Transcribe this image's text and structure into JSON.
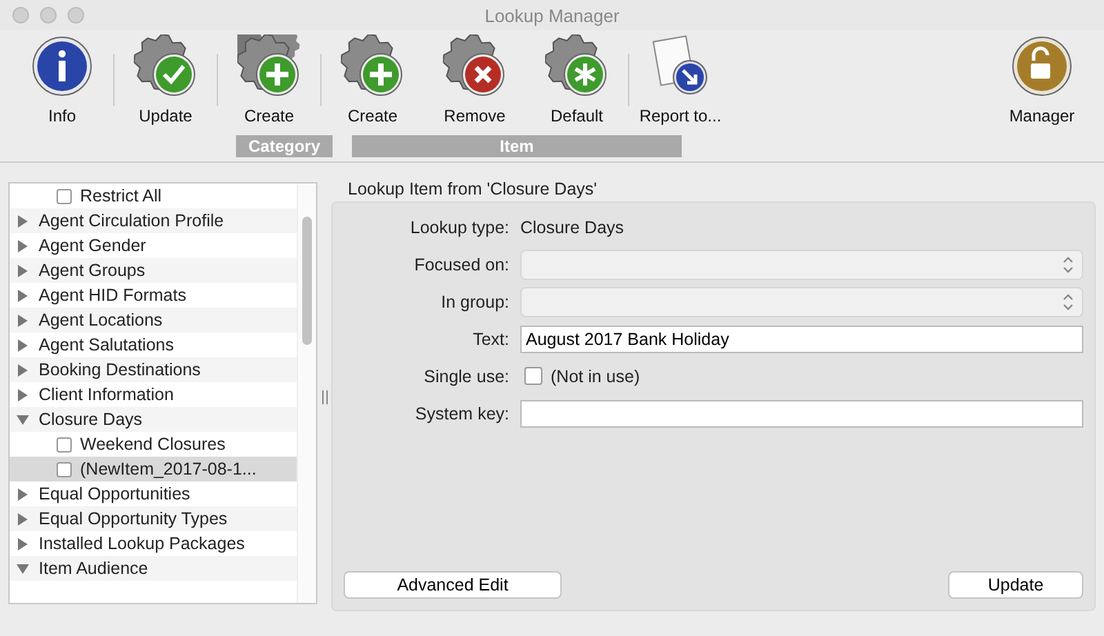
{
  "window": {
    "title": "Lookup Manager"
  },
  "toolbar": [
    {
      "label": "Info",
      "kind": "info"
    },
    {
      "label": "Update",
      "kind": "gear-check"
    },
    {
      "label": "Create",
      "kind": "gears-plus"
    },
    {
      "label": "Create",
      "kind": "gear-plus"
    },
    {
      "label": "Remove",
      "kind": "gear-remove"
    },
    {
      "label": "Default",
      "kind": "gear-star"
    },
    {
      "label": "Report to...",
      "kind": "report"
    },
    {
      "label": "Manager",
      "kind": "lock"
    }
  ],
  "toolbar_groups": [
    {
      "label": "Category",
      "kind": "category"
    },
    {
      "label": "Item",
      "kind": "item"
    }
  ],
  "tree": [
    {
      "kind": "item",
      "label": "Restrict All",
      "checked": false,
      "selected": false
    },
    {
      "kind": "group",
      "label": "Agent Circulation Profile",
      "expanded": false
    },
    {
      "kind": "group",
      "label": "Agent Gender",
      "expanded": false
    },
    {
      "kind": "group",
      "label": "Agent Groups",
      "expanded": false
    },
    {
      "kind": "group",
      "label": "Agent HID Formats",
      "expanded": false
    },
    {
      "kind": "group",
      "label": "Agent Locations",
      "expanded": false
    },
    {
      "kind": "group",
      "label": "Agent Salutations",
      "expanded": false
    },
    {
      "kind": "group",
      "label": "Booking Destinations",
      "expanded": false
    },
    {
      "kind": "group",
      "label": "Client Information",
      "expanded": false
    },
    {
      "kind": "group",
      "label": "Closure Days",
      "expanded": true,
      "children": [
        {
          "kind": "item",
          "label": "Weekend Closures",
          "checked": false,
          "selected": false
        },
        {
          "kind": "item",
          "label": "(NewItem_2017-08-1...",
          "checked": false,
          "selected": true
        }
      ]
    },
    {
      "kind": "group",
      "label": "Equal Opportunities",
      "expanded": false
    },
    {
      "kind": "group",
      "label": "Equal Opportunity Types",
      "expanded": false
    },
    {
      "kind": "group",
      "label": "Installed Lookup Packages",
      "expanded": false
    },
    {
      "kind": "group",
      "label": "Item Audience",
      "expanded": true
    }
  ],
  "detail": {
    "title": "Lookup Item from 'Closure Days'",
    "fields": [
      {
        "kind": "static",
        "label": "Lookup type:",
        "value": "Closure Days"
      },
      {
        "kind": "select",
        "label": "Focused on:",
        "disabled": true
      },
      {
        "kind": "select",
        "label": "In group:",
        "disabled": true
      },
      {
        "kind": "text",
        "label": "Text:",
        "value": "August 2017 Bank Holiday"
      },
      {
        "kind": "checkbox",
        "label": "Single use:",
        "checked": false,
        "value": "(Not in use)"
      },
      {
        "kind": "text",
        "label": "System key:"
      }
    ],
    "buttons": [
      {
        "label": "Advanced Edit"
      },
      {
        "label": "Update"
      }
    ]
  }
}
